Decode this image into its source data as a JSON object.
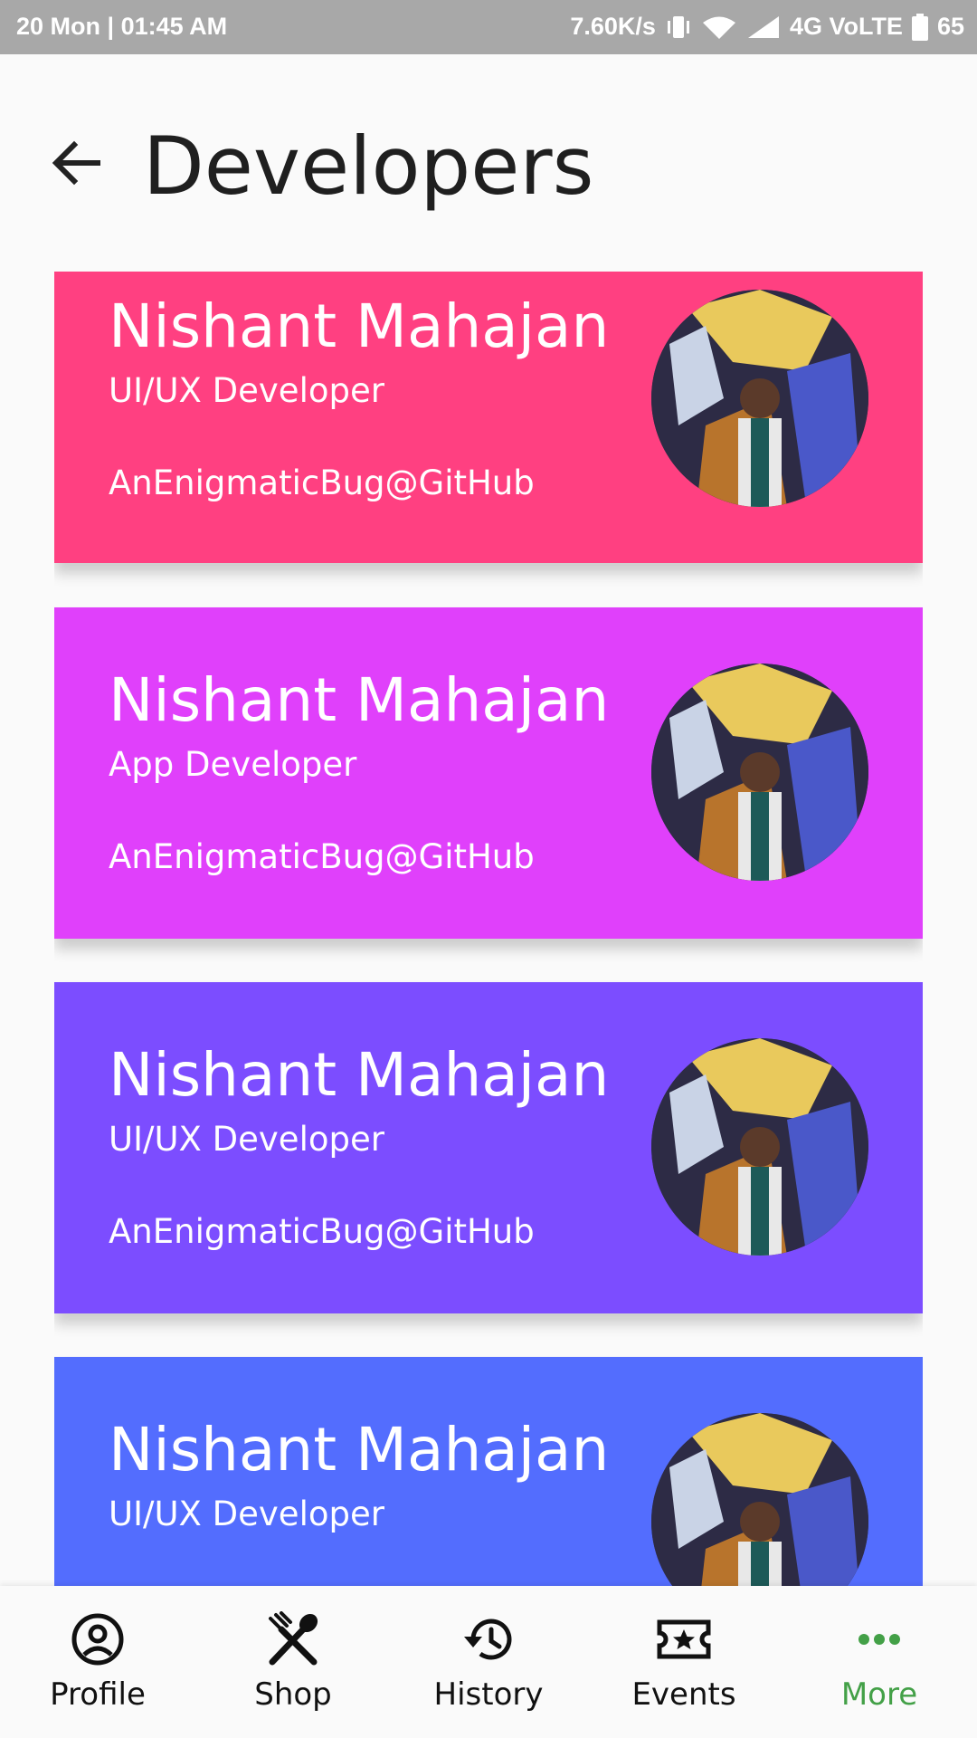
{
  "status_bar": {
    "left": "20 Mon  |  01:45 AM",
    "speed": "7.60K/s",
    "network": "4G VoLTE",
    "battery": "65"
  },
  "header": {
    "title": "Developers"
  },
  "developers": [
    {
      "name": "Nishant Mahajan",
      "role": "UI/UX Developer",
      "handle": "AnEnigmaticBug@GitHub",
      "color": "#ff4081"
    },
    {
      "name": "Nishant Mahajan",
      "role": "App Developer",
      "handle": "AnEnigmaticBug@GitHub",
      "color": "#e040fb"
    },
    {
      "name": "Nishant Mahajan",
      "role": "UI/UX Developer",
      "handle": "AnEnigmaticBug@GitHub",
      "color": "#7c4dff"
    },
    {
      "name": "Nishant Mahajan",
      "role": "UI/UX Developer",
      "handle": "",
      "color": "#536dfe"
    }
  ],
  "bottom_nav": [
    {
      "label": "Profile",
      "icon": "account-circle-icon"
    },
    {
      "label": "Shop",
      "icon": "restaurant-icon"
    },
    {
      "label": "History",
      "icon": "history-icon"
    },
    {
      "label": "Events",
      "icon": "local-activity-icon"
    },
    {
      "label": "More",
      "icon": "more-horiz-icon",
      "active": true
    }
  ],
  "colors": {
    "active": "#43a047",
    "text": "#1f1f1f"
  }
}
